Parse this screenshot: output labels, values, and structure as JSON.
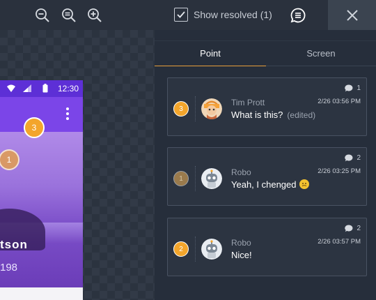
{
  "toolbar": {
    "icons": [
      "zoom-out-icon",
      "zoom-reset-icon",
      "zoom-in-icon",
      "comments-list-icon",
      "close-icon"
    ],
    "show_resolved_label": "Show resolved (1)",
    "show_resolved_checked": true
  },
  "phone": {
    "status_time": "12:30",
    "hero_name": "tson",
    "hero_number": "198",
    "pins": [
      "3",
      "1"
    ]
  },
  "sidebar": {
    "tabs": [
      {
        "label": "Point",
        "active": true
      },
      {
        "label": "Screen",
        "active": false
      }
    ],
    "comments": [
      {
        "pin": "3",
        "author": "Tim Prott",
        "date": "2/26 03:56 PM",
        "text": "What is this?",
        "edited": "(edited)",
        "count": "1",
        "avatar": "person-avatar"
      },
      {
        "pin": "1",
        "author": "Robo",
        "date": "2/26 03:25 PM",
        "text": "Yeah, I chenged",
        "count": "2",
        "avatar": "robot-avatar",
        "emoji": "grimace-emoji"
      },
      {
        "pin": "2",
        "author": "Robo",
        "date": "2/26 03:57 PM",
        "text": "Nice!",
        "count": "2",
        "avatar": "robot-avatar"
      }
    ]
  },
  "colors": {
    "accent": "#f3a52b",
    "background": "#262e3b",
    "phone_purple": "#7b45e8"
  }
}
